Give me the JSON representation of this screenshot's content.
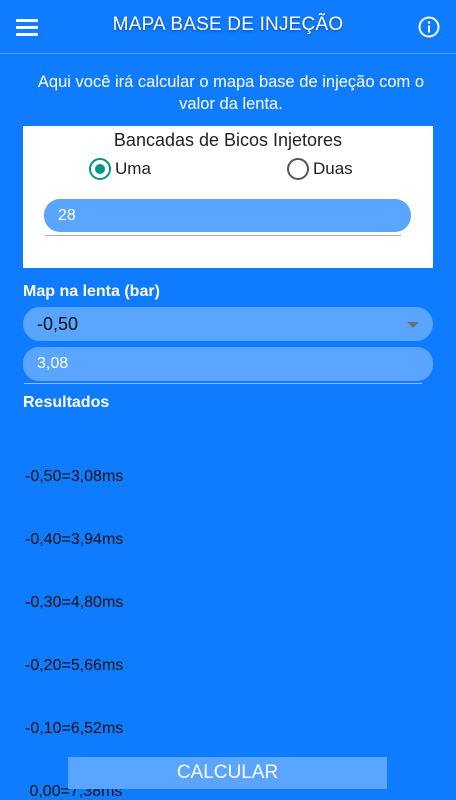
{
  "appbar": {
    "title": "MAPA BASE DE INJEÇÃO",
    "menu_icon": "hamburger-menu-icon",
    "info_icon": "info-circle-icon"
  },
  "intro": "Aqui você irá calcular o mapa base de injeção com o valor da lenta.",
  "bancadas": {
    "title": "Bancadas de Bicos Injetores",
    "options": [
      {
        "label": "Uma",
        "selected": true
      },
      {
        "label": "Duas",
        "selected": false
      }
    ],
    "value": "28"
  },
  "map_lenta": {
    "label": "Map na lenta (bar)",
    "selected": "-0,50",
    "value": "3,08"
  },
  "resultados": {
    "label": "Resultados",
    "lines": [
      "-0,50=3,08ms",
      "-0,40=3,94ms",
      "-0,30=4,80ms",
      "-0,20=5,66ms",
      "-0,10=6,52ms",
      " 0,00=7,38ms"
    ]
  },
  "calcular_label": "CALCULAR",
  "colors": {
    "background": "#0f7bff",
    "input_fill": "#5aa5ff",
    "radio_accent": "#009688"
  }
}
